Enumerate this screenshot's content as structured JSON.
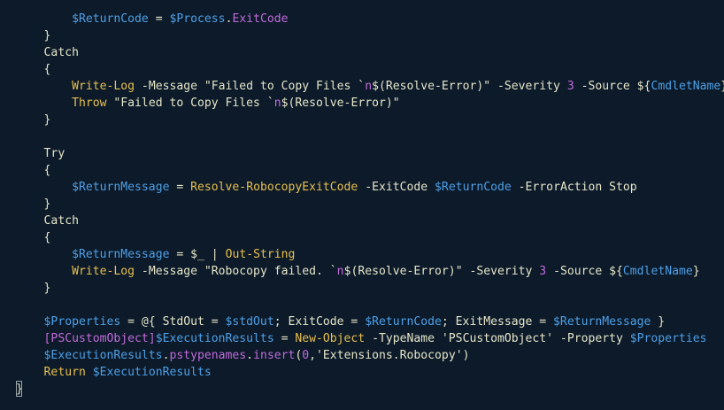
{
  "colors": {
    "background": "#0c1a2a",
    "default": "#e6e6c8",
    "variable": "#4ea0e6",
    "property": "#c06bd9",
    "command": "#e8c04e",
    "string": "#e6e6c8",
    "number": "#c06bd9",
    "type": "#c06bd9",
    "bracket": "#9aa5ad"
  },
  "lines": [
    [
      [
        "",
        "    "
      ],
      [
        "variable",
        "$"
      ],
      [
        "variable",
        "ReturnCode"
      ],
      [
        "default",
        " = "
      ],
      [
        "variable",
        "$"
      ],
      [
        "variable",
        "Process"
      ],
      [
        "default",
        "."
      ],
      [
        "property",
        "ExitCode"
      ]
    ],
    [
      [
        "",
        ""
      ],
      [
        "default",
        "}"
      ]
    ],
    [
      [
        "",
        ""
      ],
      [
        "default",
        "Catch"
      ]
    ],
    [
      [
        "",
        ""
      ],
      [
        "default",
        "{"
      ]
    ],
    [
      [
        "",
        "    "
      ],
      [
        "command",
        "Write-Log"
      ],
      [
        "default",
        " -Message \"Failed to Copy Files `"
      ],
      [
        "property",
        "n"
      ],
      [
        "default",
        "$(Resolve-Error)\" -Severity "
      ],
      [
        "number",
        "3"
      ],
      [
        "default",
        " -Source ${"
      ],
      [
        "variable",
        "CmdletName"
      ],
      [
        "default",
        "}"
      ]
    ],
    [
      [
        "",
        "    "
      ],
      [
        "command",
        "Throw"
      ],
      [
        "default",
        " \"Failed to Copy Files `"
      ],
      [
        "property",
        "n"
      ],
      [
        "default",
        "$(Resolve-Error)\""
      ]
    ],
    [
      [
        "",
        ""
      ],
      [
        "default",
        "}"
      ]
    ],
    [
      [
        "",
        ""
      ]
    ],
    [
      [
        "",
        ""
      ],
      [
        "default",
        "Try"
      ]
    ],
    [
      [
        "",
        ""
      ],
      [
        "default",
        "{"
      ]
    ],
    [
      [
        "",
        "    "
      ],
      [
        "variable",
        "$ReturnMessage"
      ],
      [
        "default",
        " = "
      ],
      [
        "command",
        "Resolve-RobocopyExitCode"
      ],
      [
        "default",
        " -ExitCode "
      ],
      [
        "variable",
        "$ReturnCode"
      ],
      [
        "default",
        " -ErrorAction Stop"
      ]
    ],
    [
      [
        "",
        ""
      ],
      [
        "default",
        "}"
      ]
    ],
    [
      [
        "",
        ""
      ],
      [
        "default",
        "Catch"
      ]
    ],
    [
      [
        "",
        ""
      ],
      [
        "default",
        "{"
      ]
    ],
    [
      [
        "",
        "    "
      ],
      [
        "variable",
        "$ReturnMessage"
      ],
      [
        "default",
        " = "
      ],
      [
        "default",
        "$_"
      ],
      [
        "default",
        " | "
      ],
      [
        "command",
        "Out-String"
      ]
    ],
    [
      [
        "",
        "    "
      ],
      [
        "command",
        "Write-Log"
      ],
      [
        "default",
        " -Message \"Robocopy failed. `"
      ],
      [
        "property",
        "n"
      ],
      [
        "default",
        "$(Resolve-Error)\" -Severity "
      ],
      [
        "number",
        "3"
      ],
      [
        "default",
        " -Source ${"
      ],
      [
        "variable",
        "CmdletName"
      ],
      [
        "default",
        "}"
      ]
    ],
    [
      [
        "",
        ""
      ],
      [
        "default",
        "}"
      ]
    ],
    [
      [
        "",
        ""
      ]
    ],
    [
      [
        "",
        ""
      ],
      [
        "variable",
        "$Properties"
      ],
      [
        "default",
        " = @{ StdOut = "
      ],
      [
        "variable",
        "$stdOut"
      ],
      [
        "default",
        "; ExitCode = "
      ],
      [
        "variable",
        "$ReturnCode"
      ],
      [
        "default",
        "; ExitMessage = "
      ],
      [
        "variable",
        "$ReturnMessage"
      ],
      [
        "default",
        " }"
      ]
    ],
    [
      [
        "",
        ""
      ],
      [
        "type",
        "[PSCustomObject]"
      ],
      [
        "variable",
        "$ExecutionResults"
      ],
      [
        "default",
        " = "
      ],
      [
        "command",
        "New-Object"
      ],
      [
        "default",
        " -TypeName 'PSCustomObject' -Property "
      ],
      [
        "variable",
        "$Properties"
      ]
    ],
    [
      [
        "",
        ""
      ],
      [
        "variable",
        "$ExecutionResults"
      ],
      [
        "default",
        "."
      ],
      [
        "property",
        "pstypenames"
      ],
      [
        "default",
        "."
      ],
      [
        "property",
        "insert"
      ],
      [
        "default",
        "("
      ],
      [
        "number",
        "0"
      ],
      [
        "default",
        ",'Extensions.Robocopy')"
      ]
    ],
    [
      [
        "",
        ""
      ],
      [
        "command",
        "Return"
      ],
      [
        "default",
        " "
      ],
      [
        "variable",
        "$ExecutionResults"
      ]
    ],
    [
      [
        "",
        ""
      ]
    ]
  ],
  "closing_brace": "}",
  "base_indent": "    "
}
